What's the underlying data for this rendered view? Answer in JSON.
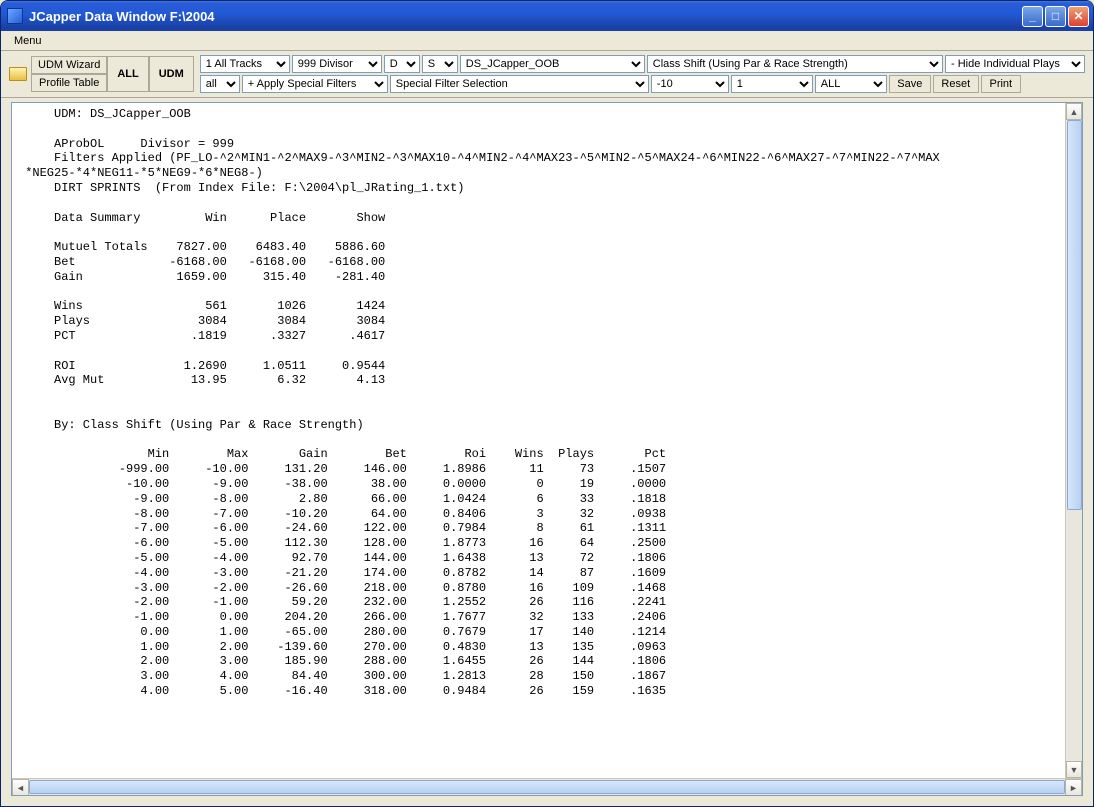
{
  "window": {
    "title": "JCapper Data Window F:\\2004"
  },
  "menubar": {
    "menu_label": "Menu"
  },
  "toolbar": {
    "udm_wizard": "UDM Wizard",
    "profile_table": "Profile Table",
    "all_btn": "ALL",
    "udm_btn": "UDM",
    "row1": {
      "tracks": "1 All Tracks",
      "divisor": "999 Divisor",
      "d": "D",
      "s": "S",
      "udm_name": "DS_JCapper_OOB",
      "class_shift": "Class Shift (Using Par & Race Strength)",
      "hide": "- Hide Individual Plays"
    },
    "row2": {
      "all": "all",
      "apply_filters": "+ Apply Special Filters",
      "special_filter": "Special Filter Selection",
      "neg10": "-10",
      "one": "1",
      "allcaps": "ALL",
      "save": "Save",
      "reset": "Reset",
      "print": "Print"
    }
  },
  "report": {
    "header": [
      "     UDM: DS_JCapper_OOB",
      "",
      "     AProbOL     Divisor = 999",
      "     Filters Applied (PF_LO-^2^MIN1-^2^MAX9-^3^MIN2-^3^MAX10-^4^MIN2-^4^MAX23-^5^MIN2-^5^MAX24-^6^MIN22-^6^MAX27-^7^MIN22-^7^MAX",
      " *NEG25-*4*NEG11-*5*NEG9-*6*NEG8-)",
      "     DIRT SPRINTS  (From Index File: F:\\2004\\pl_JRating_1.txt)",
      "",
      "     Data Summary         Win      Place       Show",
      "",
      "     Mutuel Totals    7827.00    6483.40    5886.60",
      "     Bet             -6168.00   -6168.00   -6168.00",
      "     Gain             1659.00     315.40    -281.40",
      "",
      "     Wins                 561       1026       1424",
      "     Plays               3084       3084       3084",
      "     PCT                .1819      .3327      .4617",
      "",
      "     ROI               1.2690     1.0511     0.9544",
      "     Avg Mut            13.95       6.32       4.13",
      "",
      "",
      "     By: Class Shift (Using Par & Race Strength)",
      ""
    ],
    "table_header": "                  Min        Max       Gain        Bet        Roi    Wins  Plays       Pct",
    "rows": [
      "              -999.00     -10.00     131.20     146.00     1.8986      11     73     .1507",
      "               -10.00      -9.00     -38.00      38.00     0.0000       0     19     .0000",
      "                -9.00      -8.00       2.80      66.00     1.0424       6     33     .1818",
      "                -8.00      -7.00     -10.20      64.00     0.8406       3     32     .0938",
      "                -7.00      -6.00     -24.60     122.00     0.7984       8     61     .1311",
      "                -6.00      -5.00     112.30     128.00     1.8773      16     64     .2500",
      "                -5.00      -4.00      92.70     144.00     1.6438      13     72     .1806",
      "                -4.00      -3.00     -21.20     174.00     0.8782      14     87     .1609",
      "                -3.00      -2.00     -26.60     218.00     0.8780      16    109     .1468",
      "                -2.00      -1.00      59.20     232.00     1.2552      26    116     .2241",
      "                -1.00       0.00     204.20     266.00     1.7677      32    133     .2406",
      "                 0.00       1.00     -65.00     280.00     0.7679      17    140     .1214",
      "                 1.00       2.00    -139.60     270.00     0.4830      13    135     .0963",
      "                 2.00       3.00     185.90     288.00     1.6455      26    144     .1806",
      "                 3.00       4.00      84.40     300.00     1.2813      28    150     .1867",
      "                 4.00       5.00     -16.40     318.00     0.9484      26    159     .1635"
    ]
  },
  "chart_data": {
    "type": "table",
    "title": "By: Class Shift (Using Par & Race Strength)",
    "summary": {
      "columns": [
        "Win",
        "Place",
        "Show"
      ],
      "Mutuel Totals": [
        7827.0,
        6483.4,
        5886.6
      ],
      "Bet": [
        -6168.0,
        -6168.0,
        -6168.0
      ],
      "Gain": [
        1659.0,
        315.4,
        -281.4
      ],
      "Wins": [
        561,
        1026,
        1424
      ],
      "Plays": [
        3084,
        3084,
        3084
      ],
      "PCT": [
        0.1819,
        0.3327,
        0.4617
      ],
      "ROI": [
        1.269,
        1.0511,
        0.9544
      ],
      "Avg Mut": [
        13.95,
        6.32,
        4.13
      ]
    },
    "columns": [
      "Min",
      "Max",
      "Gain",
      "Bet",
      "Roi",
      "Wins",
      "Plays",
      "Pct"
    ],
    "rows": [
      [
        -999.0,
        -10.0,
        131.2,
        146.0,
        1.8986,
        11,
        73,
        0.1507
      ],
      [
        -10.0,
        -9.0,
        -38.0,
        38.0,
        0.0,
        0,
        19,
        0.0
      ],
      [
        -9.0,
        -8.0,
        2.8,
        66.0,
        1.0424,
        6,
        33,
        0.1818
      ],
      [
        -8.0,
        -7.0,
        -10.2,
        64.0,
        0.8406,
        3,
        32,
        0.0938
      ],
      [
        -7.0,
        -6.0,
        -24.6,
        122.0,
        0.7984,
        8,
        61,
        0.1311
      ],
      [
        -6.0,
        -5.0,
        112.3,
        128.0,
        1.8773,
        16,
        64,
        0.25
      ],
      [
        -5.0,
        -4.0,
        92.7,
        144.0,
        1.6438,
        13,
        72,
        0.1806
      ],
      [
        -4.0,
        -3.0,
        -21.2,
        174.0,
        0.8782,
        14,
        87,
        0.1609
      ],
      [
        -3.0,
        -2.0,
        -26.6,
        218.0,
        0.878,
        16,
        109,
        0.1468
      ],
      [
        -2.0,
        -1.0,
        59.2,
        232.0,
        1.2552,
        26,
        116,
        0.2241
      ],
      [
        -1.0,
        0.0,
        204.2,
        266.0,
        1.7677,
        32,
        133,
        0.2406
      ],
      [
        0.0,
        1.0,
        -65.0,
        280.0,
        0.7679,
        17,
        140,
        0.1214
      ],
      [
        1.0,
        2.0,
        -139.6,
        270.0,
        0.483,
        13,
        135,
        0.0963
      ],
      [
        2.0,
        3.0,
        185.9,
        288.0,
        1.6455,
        26,
        144,
        0.1806
      ],
      [
        3.0,
        4.0,
        84.4,
        300.0,
        1.2813,
        28,
        150,
        0.1867
      ],
      [
        4.0,
        5.0,
        -16.4,
        318.0,
        0.9484,
        26,
        159,
        0.1635
      ]
    ]
  }
}
